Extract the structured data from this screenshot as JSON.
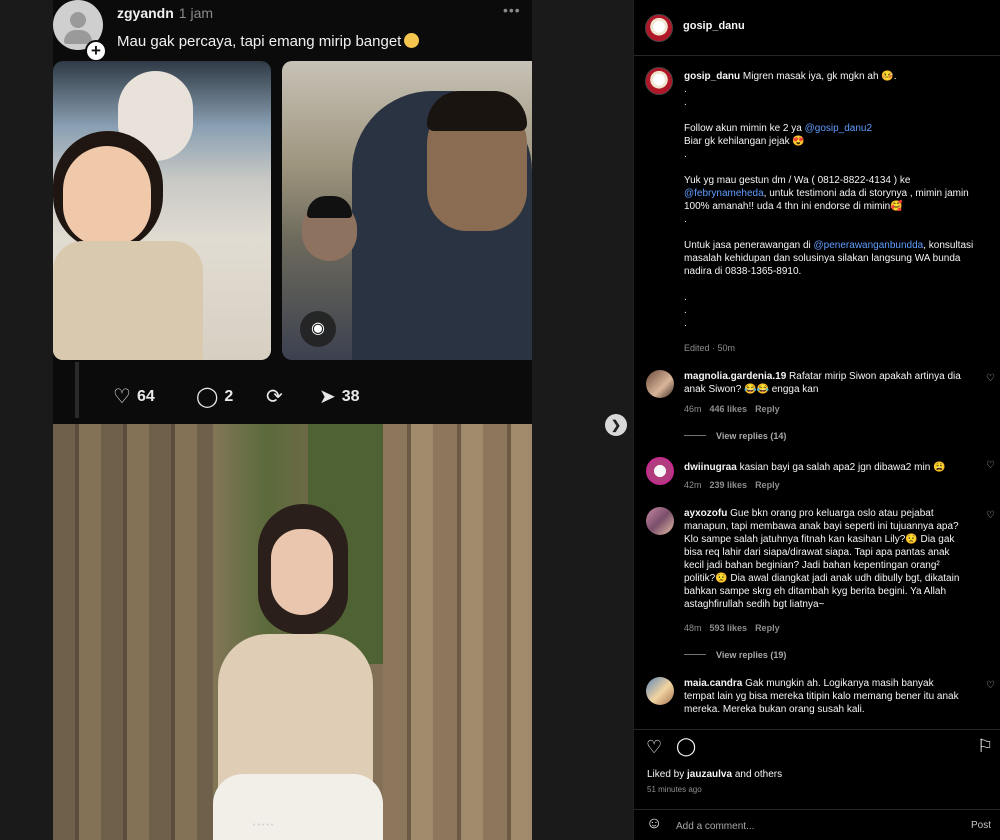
{
  "post": {
    "tweet": {
      "username": "zgyandn",
      "time": "1 jam",
      "menu": "•••",
      "text": "Mau gak percaya, tapi emang mirip banget",
      "likes": "64",
      "replies": "2",
      "shares": "38",
      "icons": [
        "heart-icon",
        "comment-icon",
        "repost-icon",
        "share-icon",
        "scan-icon"
      ]
    },
    "carousel_dots": "•••••"
  },
  "panel": {
    "header_username": "gosip_danu",
    "caption": {
      "username": "gosip_danu",
      "lines": [
        {
          "text": "Migren masak iya, gk mgkn ah 🤒."
        },
        {
          "text": "."
        },
        {
          "text": "."
        },
        {
          "text": ""
        },
        {
          "text": "Follow akun mimin ke 2 ya ",
          "link": "@gosip_danu2"
        },
        {
          "text": "Biar gk kehilangan jejak 😍"
        },
        {
          "text": "."
        },
        {
          "text": ""
        },
        {
          "text": "Yuk yg mau gestun dm / Wa ( 0812-8822-4134 ) ke"
        },
        {
          "link_first": "@febrynameheda",
          "text": ", untuk testimoni ada di storynya , mimin jamin"
        },
        {
          "text": "100% amanah!! uda 4 thn ini endorse di mimin🥰"
        },
        {
          "text": "."
        },
        {
          "text": ""
        },
        {
          "text": "Untuk jasa penerawangan di ",
          "link": "@penerawanganbundda",
          "tail": ", konsultasi"
        },
        {
          "text": "masalah kehidupan dan solusinya silakan langsung WA bunda"
        },
        {
          "text": "nadira di 0838-1365-8910."
        },
        {
          "text": ""
        },
        {
          "text": "."
        },
        {
          "text": "."
        },
        {
          "text": "."
        }
      ],
      "edited": "Edited · 50m"
    },
    "comments": [
      {
        "username": "magnolia.gardenia.19",
        "text": "Rafatar mirip Siwon apakah artinya dia anak Siwon? 😂😂 engga kan",
        "age": "46m",
        "likes": "446 likes",
        "reply": "Reply",
        "view_replies": "View replies (14)"
      },
      {
        "username": "dwiinugraa",
        "text": "kasian bayi ga salah apa2 jgn dibawa2 min 😩",
        "age": "42m",
        "likes": "239 likes",
        "reply": "Reply"
      },
      {
        "username": "ayxozofu",
        "text": "Gue bkn orang pro keluarga oslo atau pejabat manapun, tapi membawa anak bayi seperti ini tujuannya apa? Klo sampe salah jatuhnya fitnah kan kasihan Lily?😟 Dia gak bisa req lahir dari siapa/dirawat siapa. Tapi apa pantas anak kecil jadi bahan beginian? Jadi bahan kepentingan orang² politik?😟 Dia awal diangkat jadi anak udh dibully bgt, dikatain bahkan sampe skrg eh ditambah kyg berita begini. Ya Allah astaghfirullah sedih bgt liatnya~",
        "age": "48m",
        "likes": "593 likes",
        "reply": "Reply",
        "view_replies": "View replies (19)"
      },
      {
        "username": "maia.candra",
        "text": "Gak mungkin ah. Logikanya masih banyak tempat lain yg bisa mereka titipin kalo memang bener itu anak mereka. Mereka bukan orang susah kali."
      }
    ],
    "liked_by_prefix": "Liked by ",
    "liked_by_user": "jauzaulva",
    "liked_by_suffix": " and others",
    "posted_ago": "51 minutes ago",
    "add_comment_placeholder": "Add a comment...",
    "post_label": "Post"
  }
}
